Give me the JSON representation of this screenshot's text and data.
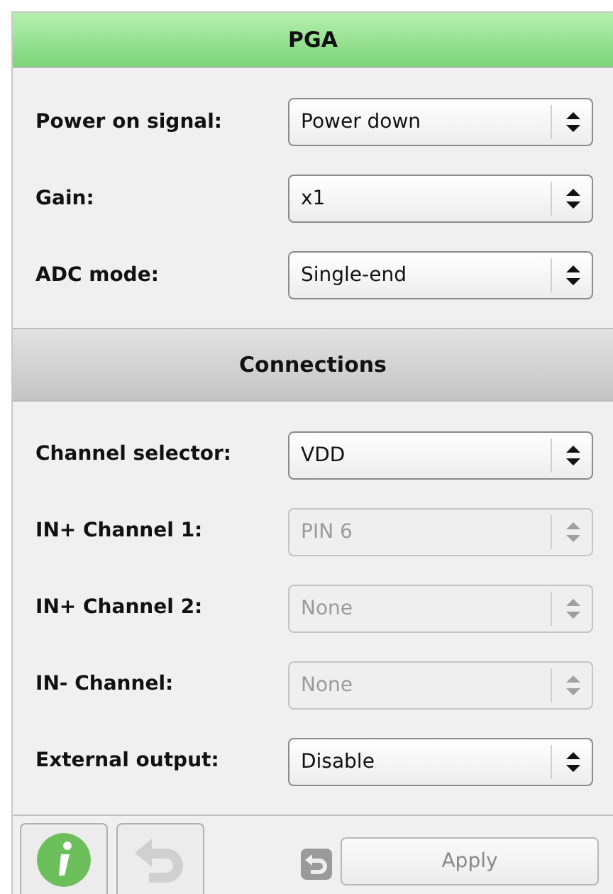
{
  "sections": [
    {
      "title": "PGA",
      "kind": "green",
      "rows": [
        {
          "label": "Power on signal:",
          "value": "Power down",
          "disabled": false
        },
        {
          "label": "Gain:",
          "value": "x1",
          "disabled": false
        },
        {
          "label": "ADC mode:",
          "value": "Single-end",
          "disabled": false
        }
      ]
    },
    {
      "title": "Connections",
      "kind": "grey",
      "rows": [
        {
          "label": "Channel selector:",
          "value": "VDD",
          "disabled": false
        },
        {
          "label": "IN+ Channel 1:",
          "value": "PIN 6",
          "disabled": true
        },
        {
          "label": "IN+ Channel 2:",
          "value": "None",
          "disabled": true
        },
        {
          "label": "IN- Channel:",
          "value": "None",
          "disabled": true
        },
        {
          "label": "External output:",
          "value": "Disable",
          "disabled": false
        }
      ]
    }
  ],
  "footer": {
    "info_button": {
      "disabled": false
    },
    "undo_button": {
      "disabled": true
    },
    "small_undo": {
      "disabled": true
    },
    "apply_button": {
      "label": "Apply",
      "disabled": true
    }
  }
}
